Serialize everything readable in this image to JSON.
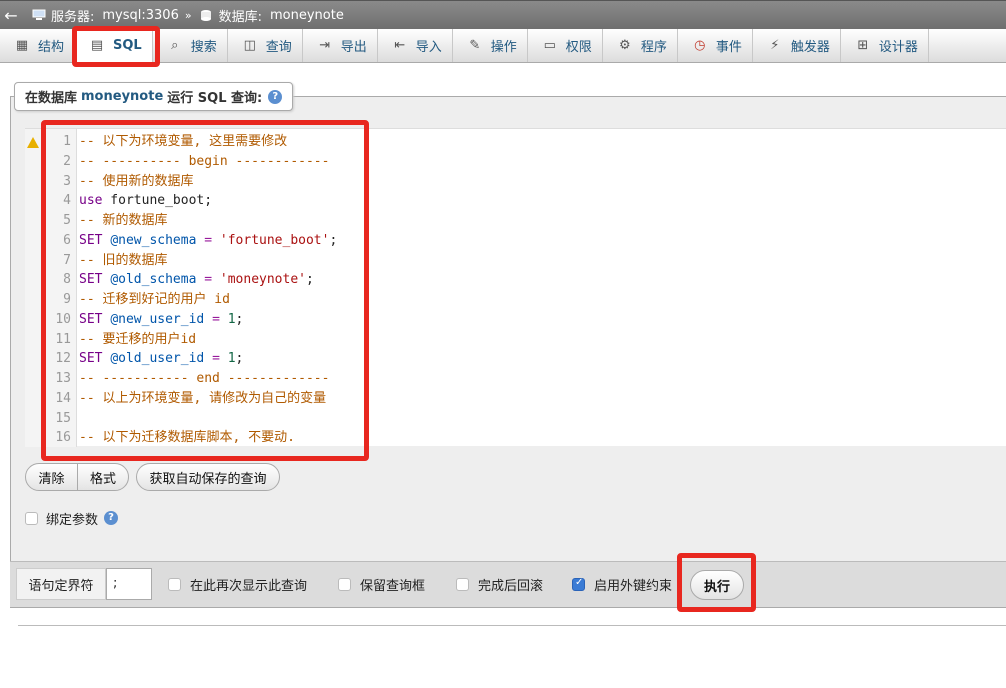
{
  "breadcrumb": {
    "server_label": "服务器:",
    "server_value": "mysql:3306",
    "separator": "»",
    "database_label": "数据库:",
    "database_value": "moneynote"
  },
  "tabs": [
    {
      "label": "结构",
      "icon": "structure-icon"
    },
    {
      "label": "SQL",
      "icon": "sql-icon",
      "active": true
    },
    {
      "label": "搜索",
      "icon": "search-icon"
    },
    {
      "label": "查询",
      "icon": "query-icon"
    },
    {
      "label": "导出",
      "icon": "export-icon"
    },
    {
      "label": "导入",
      "icon": "import-icon"
    },
    {
      "label": "操作",
      "icon": "wrench-icon"
    },
    {
      "label": "权限",
      "icon": "privileges-icon"
    },
    {
      "label": "程序",
      "icon": "routines-icon"
    },
    {
      "label": "事件",
      "icon": "clock-icon"
    },
    {
      "label": "触发器",
      "icon": "trigger-icon"
    },
    {
      "label": "设计器",
      "icon": "designer-icon"
    }
  ],
  "query_box": {
    "legend_prefix": "在数据库",
    "legend_db": "moneynote",
    "legend_suffix": "运行 SQL 查询:",
    "help": "?"
  },
  "code_lines": [
    {
      "n": "1",
      "text": "-- 以下为环境变量, 这里需要修改"
    },
    {
      "n": "2",
      "text": "-- ---------- begin ------------"
    },
    {
      "n": "3",
      "text": "-- 使用新的数据库"
    },
    {
      "n": "4",
      "text": "use fortune_boot;"
    },
    {
      "n": "5",
      "text": "-- 新的数据库"
    },
    {
      "n": "6",
      "text": "SET @new_schema = 'fortune_boot';"
    },
    {
      "n": "7",
      "text": "-- 旧的数据库"
    },
    {
      "n": "8",
      "text": "SET @old_schema = 'moneynote';"
    },
    {
      "n": "9",
      "text": "-- 迁移到好记的用户 id"
    },
    {
      "n": "10",
      "text": "SET @new_user_id = 1;"
    },
    {
      "n": "11",
      "text": "-- 要迁移的用户id"
    },
    {
      "n": "12",
      "text": "SET @old_user_id = 1;"
    },
    {
      "n": "13",
      "text": "-- ----------- end -------------"
    },
    {
      "n": "14",
      "text": "-- 以上为环境变量, 请修改为自己的变量"
    },
    {
      "n": "15",
      "text": ""
    },
    {
      "n": "16",
      "text": "-- 以下为迁移数据库脚本, 不要动."
    }
  ],
  "buttons": {
    "clear": "清除",
    "format": "格式",
    "autosave": "获取自动保存的查询",
    "go": "执行"
  },
  "bind_params": {
    "label": "绑定参数",
    "help": "?"
  },
  "options": {
    "delimiter_label": "语句定界符",
    "delimiter_value": ";",
    "show_again": "在此再次显示此查询",
    "retain_box": "保留查询框",
    "rollback": "完成后回滚",
    "foreign_keys": "启用外键约束"
  }
}
